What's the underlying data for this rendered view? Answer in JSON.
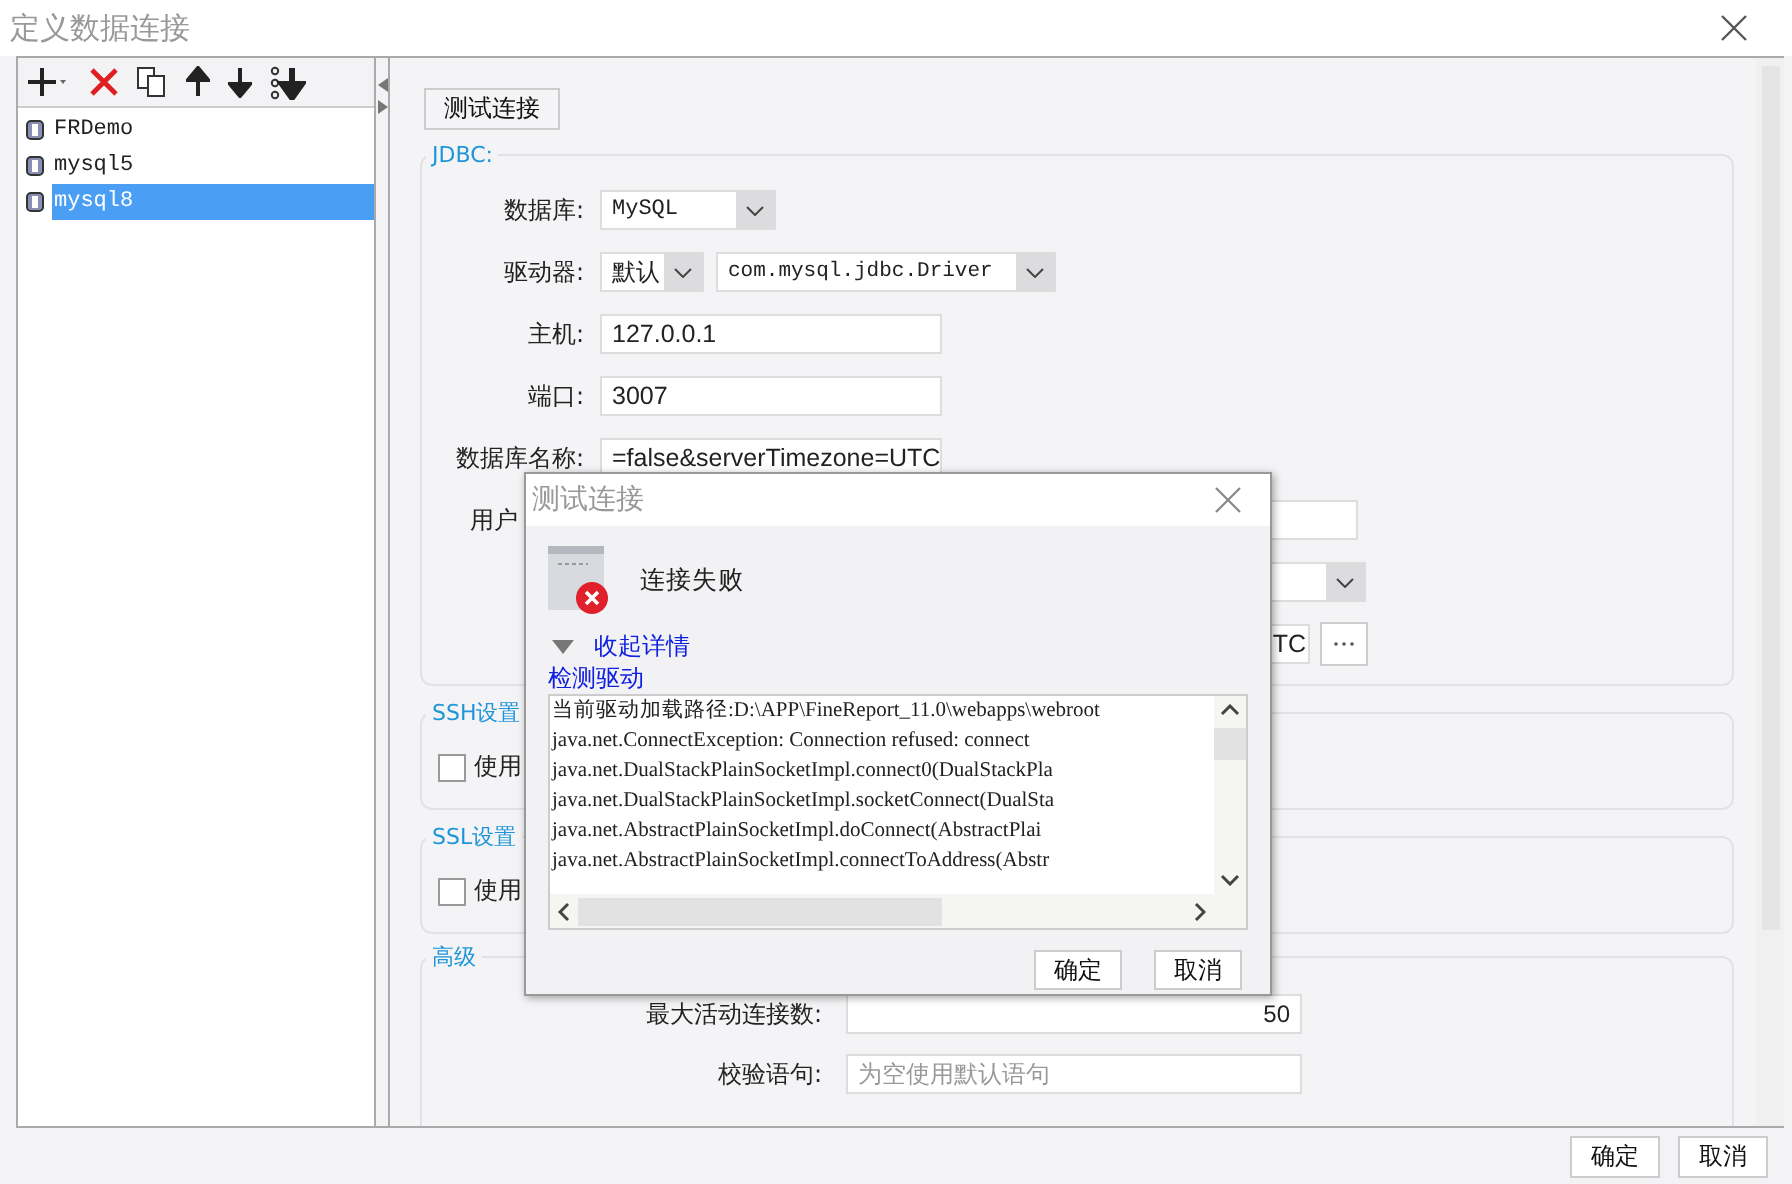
{
  "window": {
    "title": "定义数据连接"
  },
  "connections": [
    {
      "name": "FRDemo",
      "selected": false
    },
    {
      "name": "mysql5",
      "selected": false
    },
    {
      "name": "mysql8",
      "selected": true
    }
  ],
  "test_button": "测试连接",
  "jdbc": {
    "legend": "JDBC:",
    "fields": [
      {
        "kind": "combo",
        "label": "数据库:",
        "value": "MySQL"
      },
      {
        "kind": "driver",
        "label": "驱动器:",
        "value": "默认",
        "driver": "com.mysql.jdbc.Driver"
      },
      {
        "kind": "text",
        "label": "主机:",
        "value": "127.0.0.1"
      },
      {
        "kind": "text",
        "label": "端口:",
        "value": "3007"
      },
      {
        "kind": "text",
        "label": "数据库名称:",
        "value": "=false&serverTimezone=UTC"
      },
      {
        "kind": "covered",
        "label": "用户"
      },
      {
        "kind": "covered_combo"
      },
      {
        "kind": "url",
        "value": "TC"
      }
    ]
  },
  "ssh": {
    "legend": "SSH设置",
    "checkbox": {
      "label": "使用",
      "checked": false
    }
  },
  "ssl": {
    "legend": "SSL设置",
    "checkbox": {
      "label": "使用",
      "checked": false
    }
  },
  "advanced": {
    "legend": "高级",
    "fields": [
      {
        "label": "最大活动连接数:",
        "value": "50"
      },
      {
        "label": "校验语句:",
        "placeholder": "为空使用默认语句"
      }
    ]
  },
  "dialog": {
    "title": "测试连接",
    "message": "连接失败",
    "details_toggle": "收起详情",
    "expanded": true,
    "link": "检测驱动",
    "log": [
      "当前驱动加载路径:D:\\APP\\FineReport_11.0\\webapps\\webroot",
      "java.net.ConnectException: Connection refused: connect",
      "java.net.DualStackPlainSocketImpl.connect0(DualStackPla",
      "java.net.DualStackPlainSocketImpl.socketConnect(DualSta",
      "java.net.AbstractPlainSocketImpl.doConnect(AbstractPlai",
      "java.net.AbstractPlainSocketImpl.connectToAddress(Abstr"
    ],
    "buttons": [
      "确定",
      "取消"
    ]
  },
  "buttons": [
    "确定",
    "取消"
  ]
}
